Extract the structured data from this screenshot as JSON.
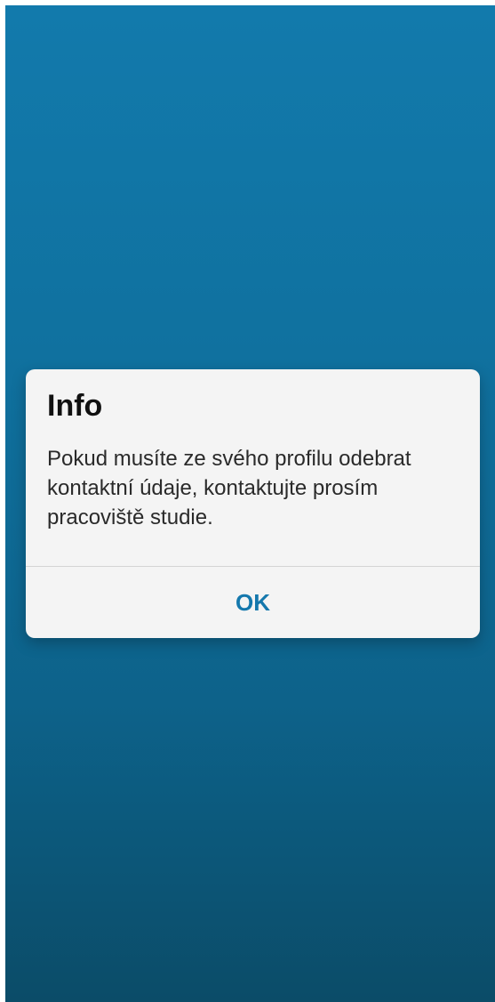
{
  "theme": {
    "background_top": "#127aac",
    "background_bottom": "#0b4c68",
    "dialog_background": "#f4f4f4",
    "accent": "#1478ad"
  },
  "dialog": {
    "title": "Info",
    "message": "Pokud musíte ze svého profilu odebrat kontaktní údaje, kontaktujte prosím pracoviště studie.",
    "ok_label": "OK"
  }
}
